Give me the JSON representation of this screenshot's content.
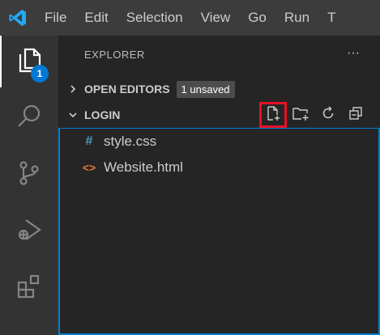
{
  "menu": {
    "items": [
      "File",
      "Edit",
      "Selection",
      "View",
      "Go",
      "Run",
      "T"
    ]
  },
  "activity": {
    "explorer_badge": "1"
  },
  "explorer": {
    "title": "EXPLORER",
    "more_label": "···",
    "open_editors": {
      "label": "OPEN EDITORS",
      "badge": "1 unsaved"
    },
    "folder": {
      "label": "LOGIN",
      "files": [
        {
          "name": "style.css",
          "icon": "#",
          "icon_name": "css-file-icon",
          "icon_color": "#519aba"
        },
        {
          "name": "Website.html",
          "icon": "<>",
          "icon_name": "html-file-icon",
          "icon_color": "#e37933"
        }
      ]
    }
  },
  "colors": {
    "accent": "#007fd4",
    "highlight": "#e81123",
    "badge": "#0078d4"
  }
}
